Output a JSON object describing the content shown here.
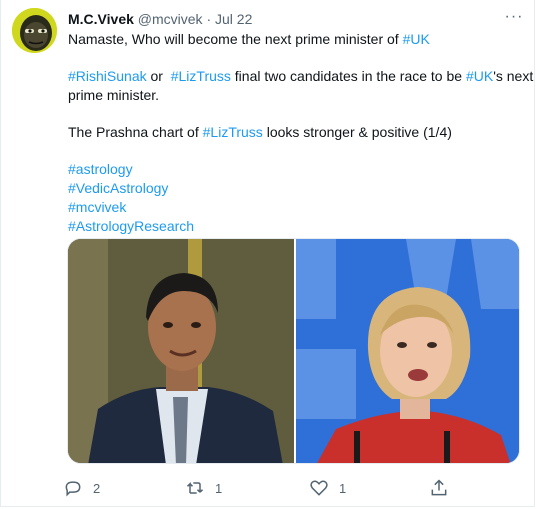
{
  "tweet": {
    "author_name": "M.C.Vivek",
    "handle": "@mcvivek",
    "separator": "·",
    "date": "Jul 22",
    "more_label": "···",
    "line1_prefix": "Namaste, Who will become the next prime minister of ",
    "line1_tag": "#UK",
    "line2_tag1": "#RishiSunak",
    "line2_mid": " or  ",
    "line2_tag2": "#LizTruss",
    "line2_suffix_before_uk": " final two candidates in the race to be ",
    "line2_tag3": "#UK",
    "line2_end": "'s next",
    "line3": "prime minister.",
    "line4_prefix": "The Prashna chart of ",
    "line4_tag": "#LizTruss",
    "line4_suffix": " looks stronger & positive (1/4)",
    "hashtags": [
      "#astrology",
      "#VedicAstrology",
      "#mcvivek",
      "#AstrologyResearch"
    ]
  },
  "media": {
    "left_description_icon": "photo-rishi-sunak",
    "right_description_icon": "photo-liz-truss"
  },
  "actions": {
    "reply_count": "2",
    "retweet_count": "1",
    "like_count": "1"
  },
  "colors": {
    "link": "#1d9bf0",
    "text": "#0f1419",
    "muted": "#536471"
  }
}
